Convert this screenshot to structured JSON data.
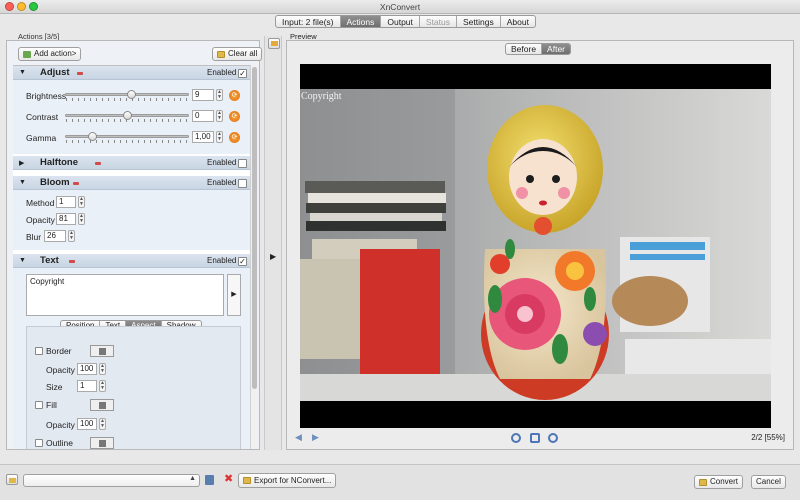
{
  "window": {
    "title": "XnConvert"
  },
  "top_tabs": [
    {
      "label": "Input: 2 file(s)",
      "state": "normal"
    },
    {
      "label": "Actions",
      "state": "active"
    },
    {
      "label": "Output",
      "state": "normal"
    },
    {
      "label": "Status",
      "state": "disabled"
    },
    {
      "label": "Settings",
      "state": "normal"
    },
    {
      "label": "About",
      "state": "normal"
    }
  ],
  "actions_panel": {
    "header": "Actions [3/5]",
    "add_action_label": "Add action>",
    "clear_all_label": "Clear all",
    "enabled_label": "Enabled",
    "adjust": {
      "title": "Adjust",
      "enabled": true,
      "brightness": {
        "label": "Brightness",
        "value": "9",
        "fraction": 0.54
      },
      "contrast": {
        "label": "Contrast",
        "value": "0",
        "fraction": 0.5
      },
      "gamma": {
        "label": "Gamma",
        "value": "1,00",
        "fraction": 0.22
      }
    },
    "halftone": {
      "title": "Halftone",
      "enabled": false
    },
    "bloom": {
      "title": "Bloom",
      "enabled": false,
      "method": {
        "label": "Method",
        "value": "1"
      },
      "opacity": {
        "label": "Opacity",
        "value": "81"
      },
      "blur": {
        "label": "Blur",
        "value": "26"
      }
    },
    "text": {
      "title": "Text",
      "enabled": true,
      "content": "Copyright",
      "subtabs": [
        {
          "label": "Position",
          "active": false
        },
        {
          "label": "Text",
          "active": false
        },
        {
          "label": "Aspect",
          "active": true
        },
        {
          "label": "Shadow",
          "active": false
        }
      ],
      "aspect": {
        "border_label": "Border",
        "border_opacity_label": "Opacity",
        "border_opacity_value": "100",
        "border_size_label": "Size",
        "border_size_value": "1",
        "fill_label": "Fill",
        "fill_opacity_label": "Opacity",
        "fill_opacity_value": "100",
        "outline_label": "Outline"
      }
    }
  },
  "preview": {
    "label": "Preview",
    "before_label": "Before",
    "after_label": "After",
    "watermark": "Copyright",
    "zoom_text": "2/2 [55%]"
  },
  "bottom": {
    "export_label": "Export for NConvert...",
    "convert_label": "Convert",
    "cancel_label": "Cancel"
  },
  "colors": {
    "accent_active_tab": "#7a7a7a",
    "reset_orange": "#e8801e",
    "remove_red": "#d24a4a",
    "section_header": "#cfd9e6"
  }
}
